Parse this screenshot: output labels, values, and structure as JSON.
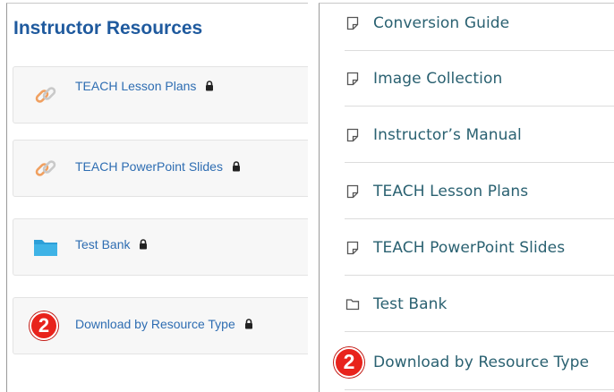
{
  "left_panel": {
    "title": "Instructor Resources",
    "items": [
      {
        "label": "TEACH Lesson Plans",
        "icon": "link-icon"
      },
      {
        "label": "TEACH PowerPoint Slides",
        "icon": "link-icon"
      },
      {
        "label": "Test Bank",
        "icon": "folder-icon"
      },
      {
        "label": "Download by Resource Type",
        "badge": "2"
      }
    ]
  },
  "right_panel": {
    "items": [
      {
        "label": "Conversion Guide",
        "icon": "document-icon"
      },
      {
        "label": "Image Collection",
        "icon": "document-icon"
      },
      {
        "label": "Instructor’s Manual",
        "icon": "document-icon"
      },
      {
        "label": "TEACH Lesson Plans",
        "icon": "document-icon"
      },
      {
        "label": "TEACH PowerPoint Slides",
        "icon": "document-icon"
      },
      {
        "label": "Test Bank",
        "icon": "folder-icon"
      },
      {
        "label": "Download by Resource Type",
        "badge": "2"
      }
    ]
  },
  "colors": {
    "title_blue": "#1f5a9e",
    "link_blue": "#2e6db2",
    "teal_text": "#2a6171",
    "badge_red": "#e8231c",
    "link_icon_orange": "#f0a060",
    "folder_blue": "#2d9fd8"
  }
}
